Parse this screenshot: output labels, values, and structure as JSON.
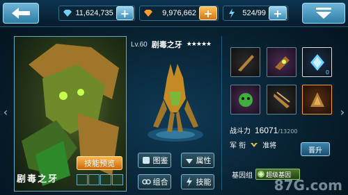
{
  "resources": {
    "crystal": {
      "value": "11,624,735",
      "icon": "crystal-icon",
      "color": "#6fd3ff"
    },
    "gem": {
      "value": "9,976,662",
      "icon": "gem-icon",
      "color": "#ff9b2f"
    },
    "energy": {
      "value": "524/99",
      "icon": "lightning-icon",
      "color": "#6fd3ff"
    }
  },
  "hero": {
    "name": "剧毒之牙",
    "level": "Lv.60",
    "title": "剧毒之牙",
    "stars": "★★★★★",
    "skill_preview_label": "技能预览"
  },
  "actions": {
    "illustration": "图鉴",
    "attributes": "属性",
    "combo": "组合",
    "skills": "技能"
  },
  "equipment_slots": [
    {
      "icon": "claw-weapon-icon",
      "style": "plain",
      "count": ""
    },
    {
      "icon": "gauntlet-icon",
      "style": "purple",
      "count": ""
    },
    {
      "icon": "crystal-shard-icon",
      "style": "white",
      "count": "0"
    },
    {
      "icon": "poison-skull-icon",
      "style": "purple",
      "count": ""
    },
    {
      "icon": "blade-claw-icon",
      "style": "plain",
      "count": ""
    },
    {
      "icon": "armor-plate-icon",
      "style": "orange",
      "count": ""
    }
  ],
  "stats": {
    "power_label": "战斗力",
    "power_value": "16071",
    "power_max": "/13200",
    "rank_label": "军 衔",
    "rank_value": "准将",
    "promote_label": "晋升"
  },
  "gene": {
    "label": "基因组",
    "badge_label": "超级基因"
  },
  "watermark": "87G.com",
  "colors": {
    "accent": "#7ab7cf",
    "orange": "#ff9b2f"
  }
}
